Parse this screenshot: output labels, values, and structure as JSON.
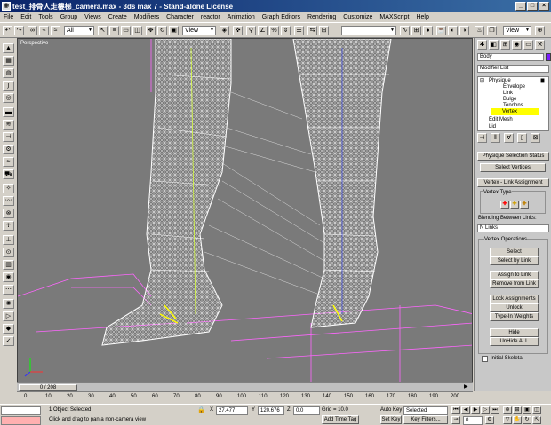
{
  "window": {
    "title": "test_排骨人走樓梯_camera.max - 3ds max 7 - Stand-alone License",
    "minimize": "_",
    "maximize": "□",
    "close": "×"
  },
  "menu": [
    "File",
    "Edit",
    "Tools",
    "Group",
    "Views",
    "Create",
    "Modifiers",
    "Character",
    "reactor",
    "Animation",
    "Graph Editors",
    "Rendering",
    "Customize",
    "MAXScript",
    "Help"
  ],
  "toolbar": {
    "selection_filter": "All",
    "ref_coord": "View",
    "named_selection": "",
    "viewport_dd": "View"
  },
  "viewport": {
    "label": "Perspective"
  },
  "command_panel": {
    "object_name": "Body",
    "object_color": "#7b1cff",
    "modifier_list": "Modifier List",
    "stack": [
      {
        "label": "Physique",
        "selected": false,
        "level": 0
      },
      {
        "label": "Envelope",
        "selected": false,
        "level": 1
      },
      {
        "label": "Link",
        "selected": false,
        "level": 1
      },
      {
        "label": "Bulge",
        "selected": false,
        "level": 1
      },
      {
        "label": "Tendons",
        "selected": false,
        "level": 1
      },
      {
        "label": "Vertex",
        "selected": true,
        "level": 1
      },
      {
        "label": "Edit Mesh",
        "selected": false,
        "level": 0
      },
      {
        "label": "Lid",
        "selected": false,
        "level": 0
      }
    ],
    "rollout_status": "Physique Selection Status",
    "select_vertices": "Select Vertices",
    "rollout_link": "Vertex - Link Assignment",
    "vertex_type_label": "Vertex Type",
    "blending_label": "Blending Between Links:",
    "blending_value": "N Links",
    "vertex_ops_label": "Vertex Operations",
    "buttons": [
      "Select",
      "Select by Link",
      "Assign to Link",
      "Remove from Link",
      "Lock Assignments",
      "Unlock Assignments",
      "Type-In Weights",
      "Hide",
      "UnHide ALL"
    ],
    "initial_skeletal": "Initial Skeletal"
  },
  "timeline": {
    "frame_display": "0 / 208",
    "ticks": [
      "0",
      "10",
      "20",
      "30",
      "40",
      "50",
      "60",
      "70",
      "80",
      "90",
      "100",
      "110",
      "120",
      "130",
      "140",
      "150",
      "160",
      "170",
      "180",
      "190",
      "200"
    ]
  },
  "status": {
    "selection": "1 Object Selected",
    "prompt": "Click and drag to pan a non-camera view",
    "x_label": "X",
    "x_value": "27.477",
    "y_label": "Y",
    "y_value": "120.676",
    "z_label": "Z",
    "z_value": "0.0",
    "grid": "Grid = 10.0",
    "add_time_tag": "Add Time Tag",
    "auto_key": "Auto Key",
    "set_key": "Set Key",
    "key_mode": "Selected",
    "key_filters": "Key Filters...",
    "current_frame": "0"
  },
  "colors": {
    "title_start": "#0a246a",
    "title_end": "#3a6ea5",
    "selected_stack": "#ffff00",
    "viewport_bg": "#7a7a7a"
  }
}
